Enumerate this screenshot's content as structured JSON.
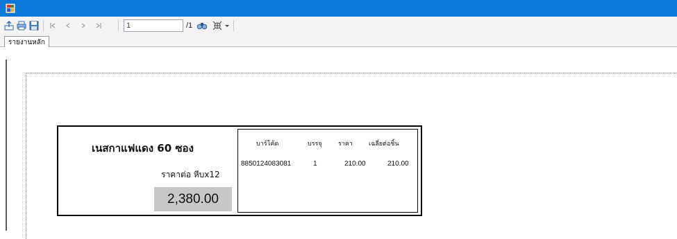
{
  "toolbar": {
    "icons": [
      "export-icon",
      "print-icon",
      "save-icon",
      "first-page-icon",
      "prev-page-icon",
      "next-page-icon",
      "last-page-icon",
      "find-icon",
      "zoom-icon"
    ],
    "current_page": "1",
    "total_pages": "/1"
  },
  "tabs": [
    {
      "label": "รายงานหลัก"
    }
  ],
  "report": {
    "product_name": "เนสกาแฟแดง 60 ซอง",
    "price_label": "ราคาต่อ หีบx12",
    "price_total": "2,380.00",
    "columns": [
      "บาร์โค้ด",
      "บรรจุ",
      "ราคา",
      "เฉลี่ยต่อชิ้น"
    ],
    "rows": [
      [
        "8850124083081",
        "1",
        "210.00",
        "210.00"
      ]
    ]
  }
}
